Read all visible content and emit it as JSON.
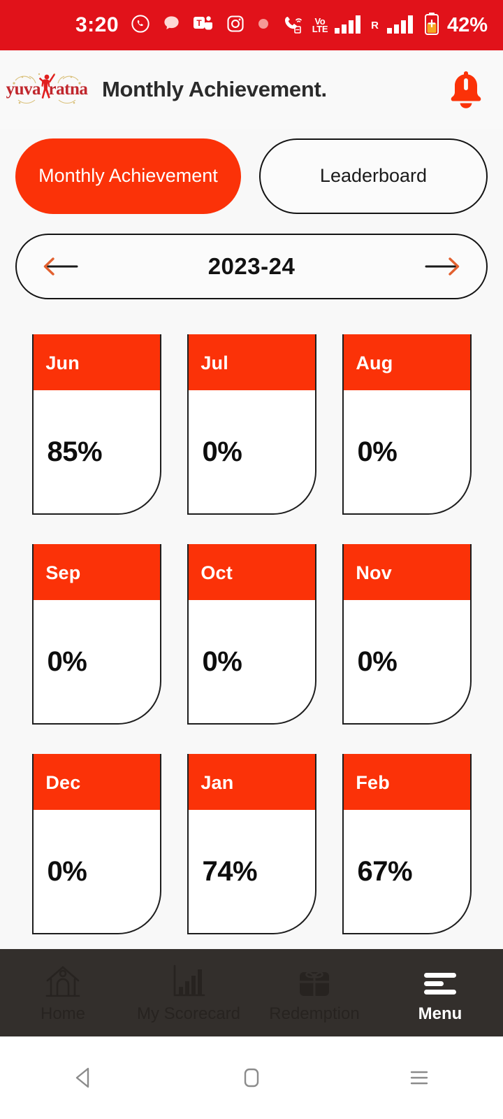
{
  "status_bar": {
    "time": "3:20",
    "battery_percent": "42%",
    "volte_line1": "Vo",
    "volte_line2": "LTE",
    "roaming_letter": "R",
    "icons": [
      "whatsapp-icon",
      "chat-bubble-icon",
      "ms-teams-icon",
      "instagram-icon",
      "dot-icon"
    ],
    "bg_color": "#e1121a"
  },
  "header": {
    "logo_text_left": "yuva",
    "logo_text_right": "ratna",
    "title": "Monthly Achievement.",
    "bell_icon": "notification-bell-icon"
  },
  "tabs": [
    {
      "label": "Monthly Achievement",
      "active": true
    },
    {
      "label": "Leaderboard",
      "active": false
    }
  ],
  "year_selector": {
    "prev_icon": "arrow-left-icon",
    "value": "2023-24",
    "next_icon": "arrow-right-icon"
  },
  "months": [
    {
      "name": "Jun",
      "percent": "85%"
    },
    {
      "name": "Jul",
      "percent": "0%"
    },
    {
      "name": "Aug",
      "percent": "0%"
    },
    {
      "name": "Sep",
      "percent": "0%"
    },
    {
      "name": "Oct",
      "percent": "0%"
    },
    {
      "name": "Nov",
      "percent": "0%"
    },
    {
      "name": "Dec",
      "percent": "0%"
    },
    {
      "name": "Jan",
      "percent": "74%"
    },
    {
      "name": "Feb",
      "percent": "67%"
    }
  ],
  "bottom_nav": [
    {
      "label": "Home",
      "icon": "home-icon",
      "active": false
    },
    {
      "label": "My Scorecard",
      "icon": "bar-chart-icon",
      "active": false
    },
    {
      "label": "Redemption",
      "icon": "gift-icon",
      "active": false
    },
    {
      "label": "Menu",
      "icon": "hamburger-menu-icon",
      "active": true
    }
  ],
  "android_nav": [
    {
      "icon": "back-triangle-icon"
    },
    {
      "icon": "home-square-icon"
    },
    {
      "icon": "recents-lines-icon"
    }
  ],
  "colors": {
    "brand_red": "#fb3208",
    "status_red": "#e1121a",
    "page_bg": "#f8f8f8",
    "nav_bg": "#332f2c",
    "logo_red": "#c0272d"
  }
}
